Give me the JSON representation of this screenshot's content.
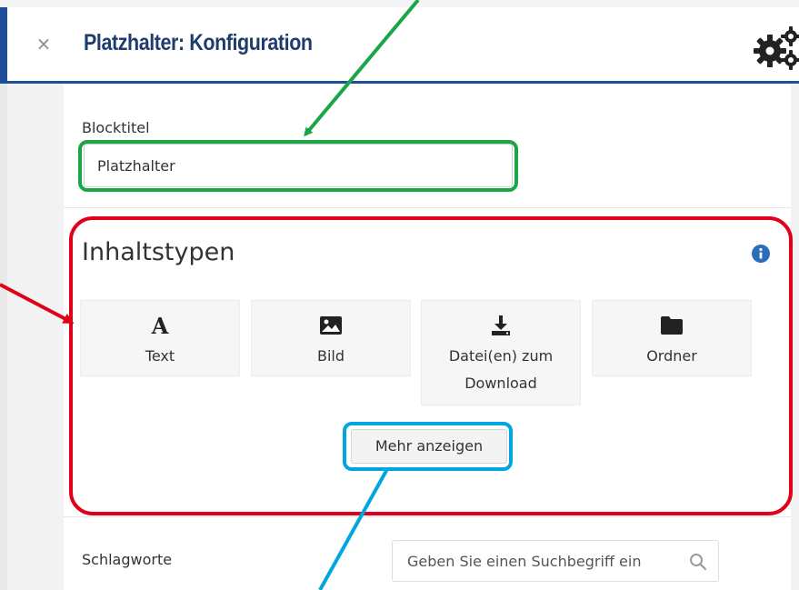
{
  "header": {
    "close_label": "×",
    "title": "Platzhalter: Konfiguration"
  },
  "form": {
    "block_title_label": "Blocktitel",
    "block_title_value": "Platzhalter",
    "content_types_heading": "Inhaltstypen",
    "content_types": [
      {
        "label": "Text",
        "icon": "font-icon"
      },
      {
        "label": "Bild",
        "icon": "image-icon"
      },
      {
        "label": "Datei(en) zum Download",
        "icon": "download-icon"
      },
      {
        "label": "Ordner",
        "icon": "folder-icon"
      }
    ],
    "more_button": "Mehr anzeigen",
    "keywords_label": "Schlagworte",
    "keywords_placeholder": "Geben Sie einen Suchbegriff ein"
  },
  "colors": {
    "title": "#1e3c6e",
    "header_border": "#1f4e99",
    "info_icon": "#2a6ebb",
    "annotation_green": "#1aa648",
    "annotation_red": "#e0001a",
    "annotation_blue": "#00a6df"
  }
}
